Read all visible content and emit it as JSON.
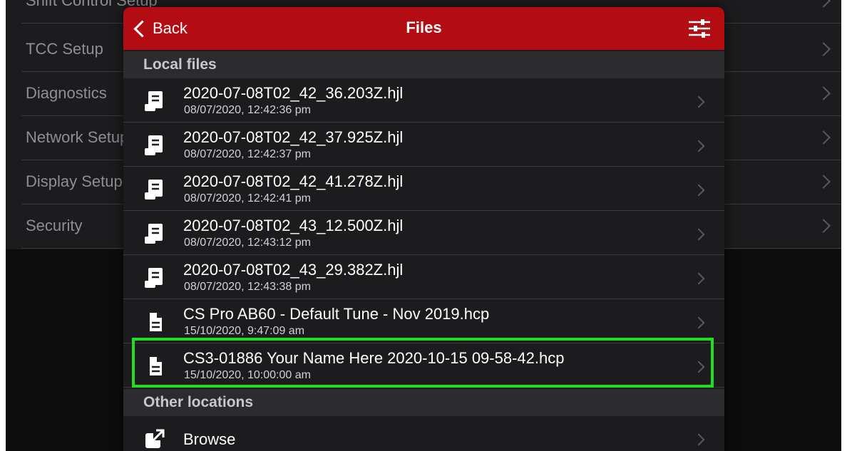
{
  "background_menu": {
    "items": [
      {
        "label": "Shift Control Setup"
      },
      {
        "label": "TCC Setup"
      },
      {
        "label": "Diagnostics"
      },
      {
        "label": "Network Setup"
      },
      {
        "label": "Display Setup"
      },
      {
        "label": "Security"
      }
    ]
  },
  "navbar": {
    "back_label": "Back",
    "title": "Files",
    "bar_color": "#b30c12"
  },
  "sections": {
    "local_files_header": "Local files",
    "other_locations_header": "Other locations"
  },
  "local_files": [
    {
      "name": "2020-07-08T02_42_36.203Z.hjl",
      "date": "08/07/2020, 12:42:36 pm",
      "icon": "log-file-icon"
    },
    {
      "name": "2020-07-08T02_42_37.925Z.hjl",
      "date": "08/07/2020, 12:42:37 pm",
      "icon": "log-file-icon"
    },
    {
      "name": "2020-07-08T02_42_41.278Z.hjl",
      "date": "08/07/2020, 12:42:41 pm",
      "icon": "log-file-icon"
    },
    {
      "name": "2020-07-08T02_43_12.500Z.hjl",
      "date": "08/07/2020, 12:43:12 pm",
      "icon": "log-file-icon"
    },
    {
      "name": "2020-07-08T02_43_29.382Z.hjl",
      "date": "08/07/2020, 12:43:38 pm",
      "icon": "log-file-icon"
    },
    {
      "name": "CS Pro AB60 - Default Tune - Nov 2019.hcp",
      "date": "15/10/2020, 9:47:09 am",
      "icon": "document-icon"
    },
    {
      "name": "CS3-01886 Your Name Here 2020-10-15 09-58-42.hcp",
      "date": "15/10/2020, 10:00:00 am",
      "icon": "document-icon"
    }
  ],
  "other_locations": [
    {
      "label": "Browse",
      "icon": "external-link-icon"
    }
  ],
  "highlight_color": "#22dd22"
}
